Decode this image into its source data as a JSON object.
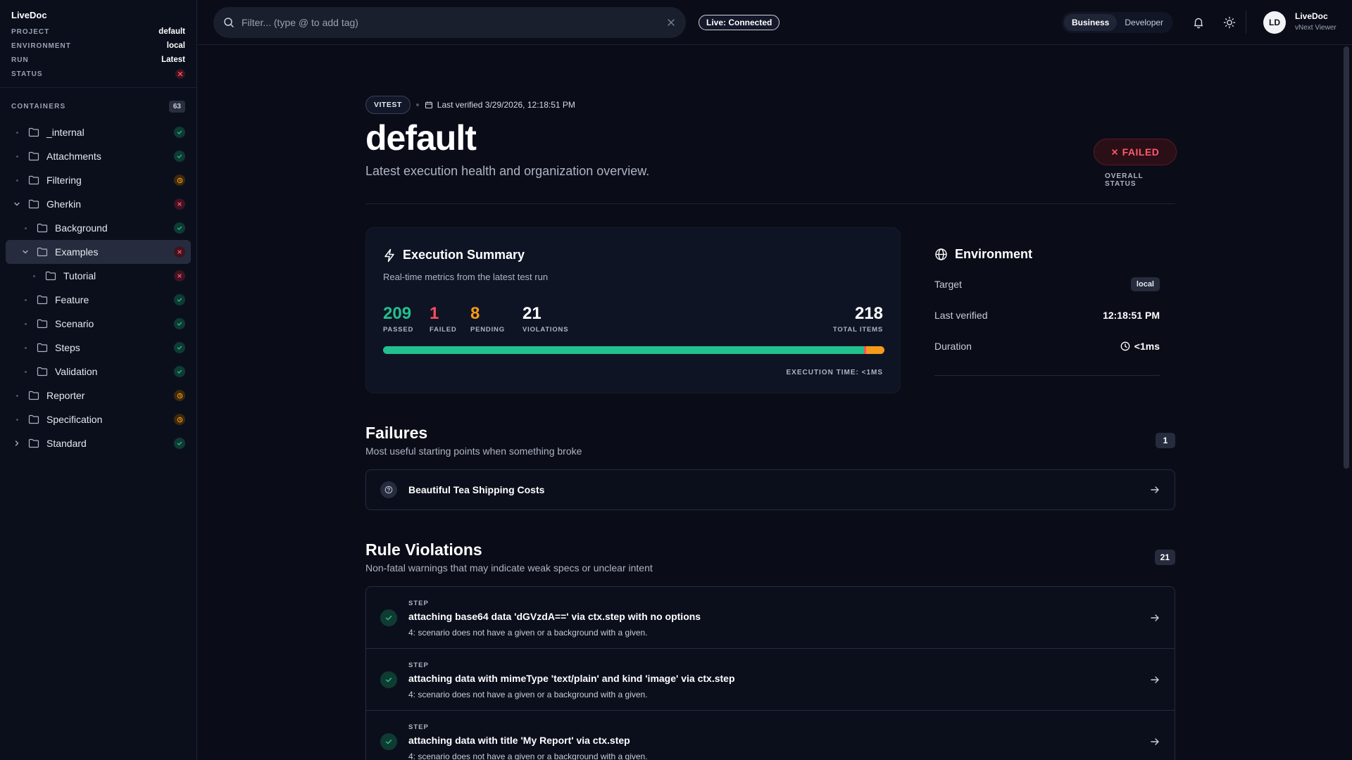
{
  "app": {
    "brand": "LiveDoc"
  },
  "sidebar": {
    "meta": [
      {
        "key": "PROJECT",
        "value": "default"
      },
      {
        "key": "ENVIRONMENT",
        "value": "local"
      },
      {
        "key": "RUN",
        "value": "Latest"
      },
      {
        "key": "STATUS",
        "value": "",
        "status": "failed"
      }
    ],
    "containers_label": "CONTAINERS",
    "containers_count": "63",
    "tree": [
      {
        "label": "_internal",
        "level": 0,
        "lead": "dot",
        "status": "pass"
      },
      {
        "label": "Attachments",
        "level": 0,
        "lead": "dot",
        "status": "pass"
      },
      {
        "label": "Filtering",
        "level": 0,
        "lead": "dot",
        "status": "pending"
      },
      {
        "label": "Gherkin",
        "level": 0,
        "lead": "chevron-down",
        "status": "fail"
      },
      {
        "label": "Background",
        "level": 1,
        "lead": "dot",
        "status": "pass"
      },
      {
        "label": "Examples",
        "level": 1,
        "lead": "chevron-down",
        "status": "fail",
        "selected": true
      },
      {
        "label": "Tutorial",
        "level": 2,
        "lead": "dot",
        "status": "fail"
      },
      {
        "label": "Feature",
        "level": 1,
        "lead": "dot",
        "status": "pass"
      },
      {
        "label": "Scenario",
        "level": 1,
        "lead": "dot",
        "status": "pass"
      },
      {
        "label": "Steps",
        "level": 1,
        "lead": "dot",
        "status": "pass"
      },
      {
        "label": "Validation",
        "level": 1,
        "lead": "dot",
        "status": "pass"
      },
      {
        "label": "Reporter",
        "level": 0,
        "lead": "dot",
        "status": "pending"
      },
      {
        "label": "Specification",
        "level": 0,
        "lead": "dot",
        "status": "pending"
      },
      {
        "label": "Standard",
        "level": 0,
        "lead": "chevron-right",
        "status": "pass"
      }
    ]
  },
  "topbar": {
    "search_placeholder": "Filter... (type @ to add tag)",
    "live_label": "Live: Connected",
    "view_modes": [
      "Business",
      "Developer"
    ],
    "active_view": "Business",
    "user": {
      "initials": "LD",
      "name": "LiveDoc",
      "role": "vNext Viewer"
    }
  },
  "page": {
    "framework": "VITEST",
    "last_verified": "Last verified 3/29/2026, 12:18:51 PM",
    "title": "default",
    "subtitle": "Latest execution health and organization overview.",
    "overall_status": "FAILED",
    "overall_status_label": "OVERALL STATUS"
  },
  "summary": {
    "title": "Execution Summary",
    "subtitle": "Real-time metrics from the latest test run",
    "passed": "209",
    "passed_label": "PASSED",
    "failed": "1",
    "failed_label": "FAILED",
    "pending": "8",
    "pending_label": "PENDING",
    "violations": "21",
    "violations_label": "VIOLATIONS",
    "total": "218",
    "total_label": "TOTAL ITEMS",
    "progress": {
      "passed": 209,
      "failed": 1,
      "pending": 8
    },
    "exec_time": "EXECUTION TIME: <1MS"
  },
  "environment": {
    "title": "Environment",
    "rows": [
      {
        "key": "Target",
        "value": "local"
      },
      {
        "key": "Last verified",
        "value": "12:18:51 PM"
      },
      {
        "key": "Duration",
        "value": "<1ms"
      }
    ]
  },
  "failures": {
    "title": "Failures",
    "subtitle": "Most useful starting points when something broke",
    "count": "1",
    "items": [
      {
        "title": "Beautiful Tea Shipping Costs"
      }
    ]
  },
  "violations": {
    "title": "Rule Violations",
    "subtitle": "Non-fatal warnings that may indicate weak specs or unclear intent",
    "count": "21",
    "items": [
      {
        "kind": "STEP",
        "title": "attaching base64 data 'dGVzdA==' via ctx.step with no options",
        "desc": "4: scenario does not have a given or a background with a given."
      },
      {
        "kind": "STEP",
        "title": "attaching data with mimeType 'text/plain' and kind 'image' via ctx.step",
        "desc": "4: scenario does not have a given or a background with a given."
      },
      {
        "kind": "STEP",
        "title": "attaching data with title 'My Report' via ctx.step",
        "desc": "4: scenario does not have a given or a background with a given."
      }
    ]
  },
  "colors": {
    "pass": "#22c08e",
    "fail": "#ff4d5e",
    "pending": "#f59a1b",
    "bg": "#0a0d18"
  }
}
